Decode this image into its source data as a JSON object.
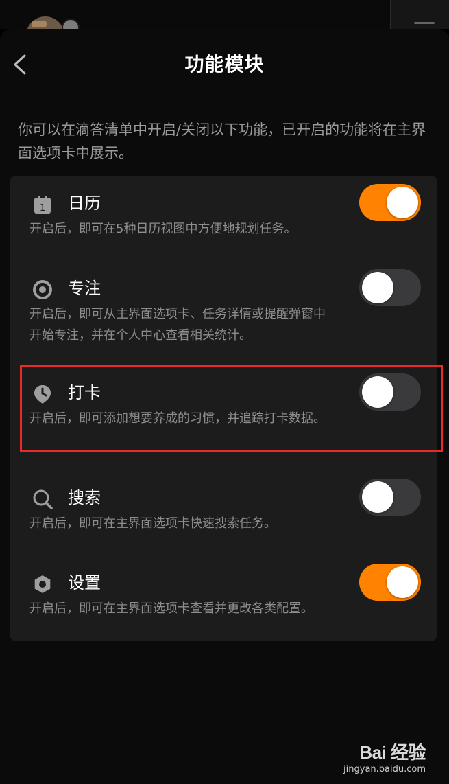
{
  "header": {
    "title": "功能模块",
    "back_icon": "chevron-left-icon"
  },
  "intro": "你可以在滴答清单中开启/关闭以下功能，已开启的功能将在主界面选项卡中展示。",
  "colors": {
    "accent": "#ff8200",
    "toggle_off": "#3a3a3c",
    "highlight": "#e82a2a"
  },
  "features": [
    {
      "icon": "calendar-icon",
      "name": "日历",
      "desc": "开启后，即可在5种日历视图中方便地规划任务。",
      "enabled": true
    },
    {
      "icon": "focus-icon",
      "name": "专注",
      "desc": "开启后，即可从主界面选项卡、任务详情或提醒弹窗中开始专注，并在个人中心查看相关统计。",
      "enabled": false
    },
    {
      "icon": "habit-icon",
      "name": "打卡",
      "desc": "开启后，即可添加想要养成的习惯，并追踪打卡数据。",
      "enabled": false
    },
    {
      "icon": "search-icon",
      "name": "搜索",
      "desc": "开启后，即可在主界面选项卡快速搜索任务。",
      "enabled": false
    },
    {
      "icon": "settings-icon",
      "name": "设置",
      "desc": "开启后，即可在主界面选项卡查看并更改各类配置。",
      "enabled": true
    }
  ],
  "calendar_icon_number": "1",
  "watermark": {
    "brand": "Bai 经验",
    "url": "jingyan.baidu.com"
  }
}
